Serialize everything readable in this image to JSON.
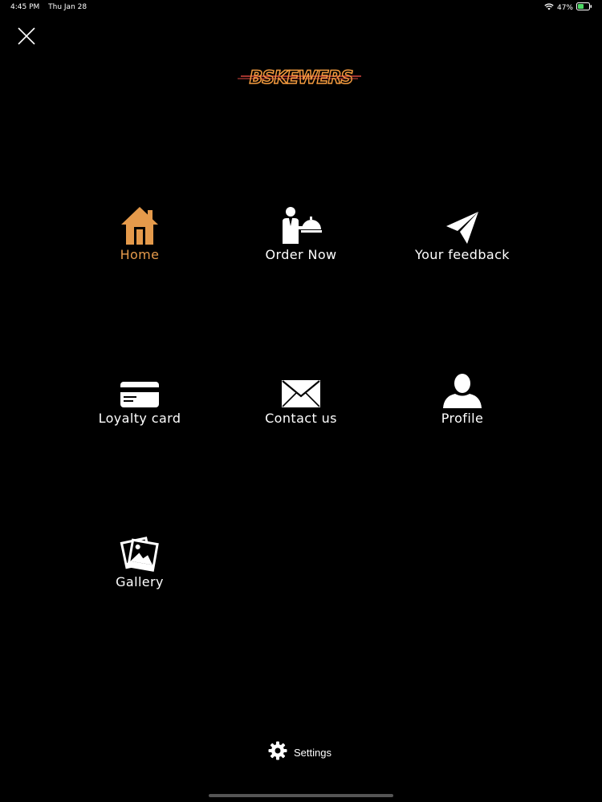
{
  "status_bar": {
    "time": "4:45 PM",
    "date": "Thu Jan 28",
    "battery": "47%"
  },
  "logo": {
    "text": "BSKEWERS"
  },
  "menu": {
    "items": [
      {
        "label": "Home",
        "icon": "home-icon",
        "active": true
      },
      {
        "label": "Order Now",
        "icon": "waiter-cloche-icon",
        "active": false
      },
      {
        "label": "Your feedback",
        "icon": "paper-plane-icon",
        "active": false
      },
      {
        "label": "Loyalty card",
        "icon": "credit-card-icon",
        "active": false
      },
      {
        "label": "Contact us",
        "icon": "envelope-icon",
        "active": false
      },
      {
        "label": "Profile",
        "icon": "person-icon",
        "active": false
      },
      {
        "label": "Gallery",
        "icon": "photos-icon",
        "active": false
      }
    ]
  },
  "settings": {
    "label": "Settings",
    "icon": "gear-icon"
  },
  "colors": {
    "background": "#000000",
    "accent": "#e59a4b",
    "text": "#ffffff",
    "logo_red": "#d8463e",
    "logo_orange": "#f29a3e"
  }
}
